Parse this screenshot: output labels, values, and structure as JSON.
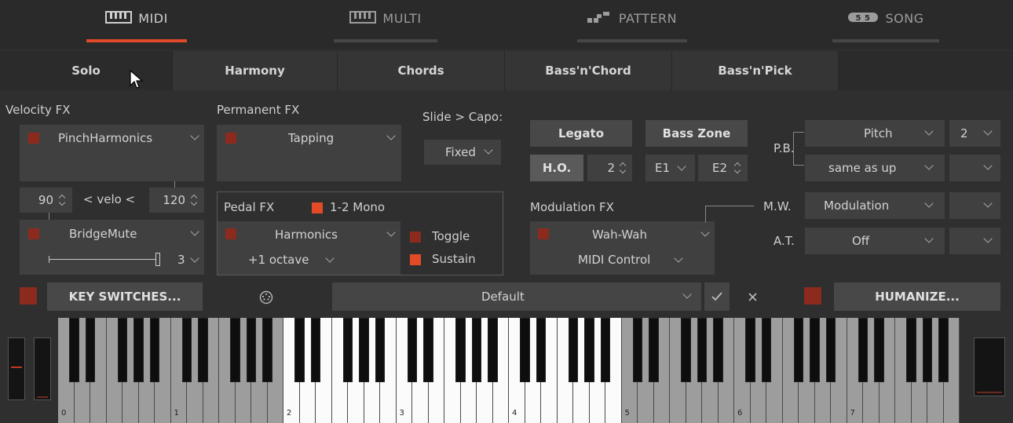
{
  "nav": {
    "tabs": [
      {
        "label": "MIDI",
        "icon": "piano-icon"
      },
      {
        "label": "MULTI",
        "icon": "piano-icon"
      },
      {
        "label": "PATTERN",
        "icon": "pattern-icon"
      },
      {
        "label": "SONG",
        "icon": "song-icon"
      }
    ],
    "active": "MIDI"
  },
  "subtabs": [
    "Solo",
    "Harmony",
    "Chords",
    "Bass'n'Chord",
    "Bass'n'Pick"
  ],
  "velocity_fx": {
    "title": "Velocity FX",
    "fx1": "PinchHarmonics",
    "low": "90",
    "mid_label": "< velo <",
    "high": "120",
    "fx2": "BridgeMute",
    "fx2_value": "3"
  },
  "permanent_fx": {
    "title": "Permanent FX",
    "fx": "Tapping"
  },
  "slide_capo": {
    "label": "Slide > Capo:",
    "value": "Fixed"
  },
  "pedal_fx": {
    "title": "Pedal FX",
    "mono_label": "1-2 Mono",
    "fx": "Harmonics",
    "option": "+1 octave",
    "toggle_label": "Toggle",
    "sustain_label": "Sustain"
  },
  "legato": {
    "label": "Legato",
    "ho_label": "H.O.",
    "ho_value": "2"
  },
  "bass_zone": {
    "label": "Bass Zone",
    "low": "E1",
    "high": "E2"
  },
  "modulation_fx": {
    "title": "Modulation FX",
    "fx": "Wah-Wah",
    "control": "MIDI Control"
  },
  "controllers": {
    "pb_label": "P.B.",
    "pb_up": "Pitch",
    "pb_up_value": "2",
    "pb_down": "same as up",
    "mw_label": "M.W.",
    "mw": "Modulation",
    "at_label": "A.T.",
    "at": "Off"
  },
  "bottom": {
    "key_switches": "KEY SWITCHES...",
    "preset": "Default",
    "humanize": "HUMANIZE..."
  },
  "keyboard": {
    "octave_labels": [
      "0",
      "1",
      "2",
      "3",
      "4",
      "5",
      "6",
      "7"
    ]
  },
  "colors": {
    "accent": "#e34b26",
    "led_off": "#8c2a1e",
    "panel": "#2f2f2f"
  }
}
